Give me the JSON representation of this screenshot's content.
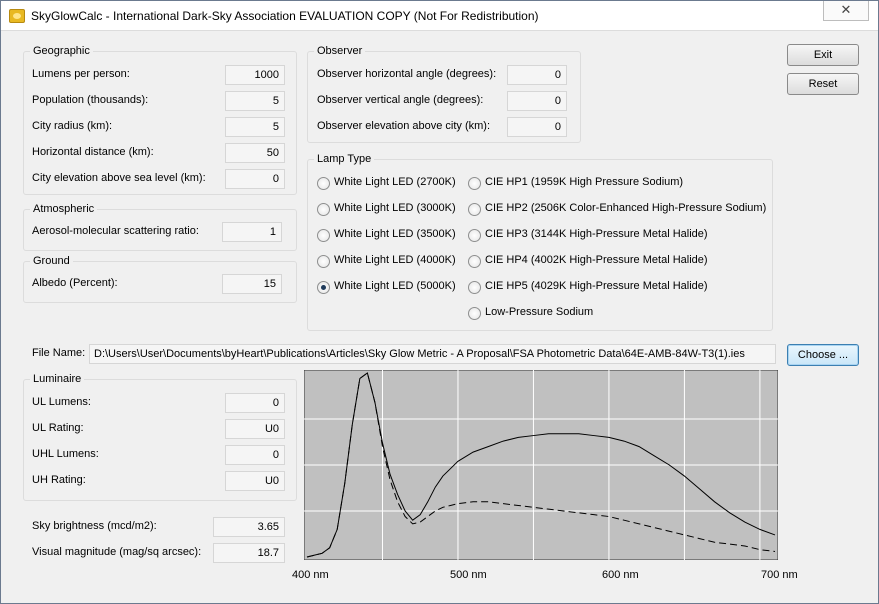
{
  "window": {
    "title": "SkyGlowCalc - International Dark-Sky Association EVALUATION COPY (Not For Redistribution)",
    "close_label": "✕"
  },
  "geographic": {
    "title": "Geographic",
    "fields": [
      {
        "label": "Lumens per person:",
        "value": "1000"
      },
      {
        "label": "Population (thousands):",
        "value": "5"
      },
      {
        "label": "City radius (km):",
        "value": "5"
      },
      {
        "label": "Horizontal distance (km):",
        "value": "50"
      },
      {
        "label": "City elevation above sea level (km):",
        "value": "0"
      }
    ]
  },
  "atmospheric": {
    "title": "Atmospheric",
    "label": "Aerosol-molecular scattering ratio:",
    "value": "1"
  },
  "ground": {
    "title": "Ground",
    "label": "Albedo (Percent):",
    "value": "15"
  },
  "observer": {
    "title": "Observer",
    "fields": [
      {
        "label": "Observer horizontal angle (degrees):",
        "value": "0"
      },
      {
        "label": "Observer vertical angle (degrees):",
        "value": "0"
      },
      {
        "label": "Observer elevation above city (km):",
        "value": "0"
      }
    ]
  },
  "lamp_type": {
    "title": "Lamp Type",
    "left": [
      {
        "label": "White Light LED (2700K)",
        "checked": false
      },
      {
        "label": "White Light LED (3000K)",
        "checked": false
      },
      {
        "label": "White Light LED (3500K)",
        "checked": false
      },
      {
        "label": "White Light LED (4000K)",
        "checked": false
      },
      {
        "label": "White Light LED (5000K)",
        "checked": true
      }
    ],
    "right": [
      {
        "label": "CIE HP1 (1959K High Pressure Sodium)",
        "checked": false
      },
      {
        "label": "CIE HP2 (2506K Color-Enhanced High-Pressure Sodium)",
        "checked": false
      },
      {
        "label": "CIE HP3 (3144K High-Pressure Metal Halide)",
        "checked": false
      },
      {
        "label": "CIE HP4 (4002K High-Pressure Metal Halide)",
        "checked": false
      },
      {
        "label": "CIE HP5 (4029K High-Pressure Metal Halide)",
        "checked": false
      },
      {
        "label": "Low-Pressure Sodium",
        "checked": false
      }
    ]
  },
  "buttons": {
    "exit": "Exit",
    "reset": "Reset",
    "choose": "Choose ..."
  },
  "file": {
    "label": "File Name:",
    "value": "D:\\Users\\User\\Documents\\byHeart\\Publications\\Articles\\Sky Glow Metric - A Proposal\\FSA Photometric Data\\64E-AMB-84W-T3(1).ies"
  },
  "luminaire": {
    "title": "Luminaire",
    "fields": [
      {
        "label": "UL Lumens:",
        "value": "0"
      },
      {
        "label": "UL Rating:",
        "value": "U0"
      },
      {
        "label": "UHL Lumens:",
        "value": "0"
      },
      {
        "label": "UH Rating:",
        "value": "U0"
      }
    ]
  },
  "results": [
    {
      "label": "Sky brightness (mcd/m2):",
      "value": "3.65"
    },
    {
      "label": "Visual magnitude (mag/sq arcsec):",
      "value": "18.7"
    }
  ],
  "chart_data": {
    "type": "line",
    "x_tick_labels": [
      "400 nm",
      "500 nm",
      "600 nm",
      "700 nm"
    ],
    "xlim": [
      400,
      710
    ],
    "ylim": [
      0,
      1
    ],
    "grid": true,
    "background_color": "#c0c0c0",
    "series": [
      {
        "style": "solid",
        "x": [
          400,
          405,
          410,
          415,
          420,
          425,
          430,
          435,
          440,
          445,
          450,
          455,
          460,
          465,
          470,
          475,
          480,
          485,
          490,
          495,
          500,
          510,
          520,
          530,
          540,
          550,
          560,
          570,
          580,
          590,
          600,
          610,
          620,
          630,
          640,
          650,
          660,
          670,
          680,
          690,
          700,
          710
        ],
        "y": [
          0.0,
          0.01,
          0.02,
          0.05,
          0.15,
          0.4,
          0.72,
          0.97,
          1.0,
          0.84,
          0.62,
          0.45,
          0.34,
          0.25,
          0.2,
          0.23,
          0.3,
          0.38,
          0.44,
          0.48,
          0.52,
          0.57,
          0.6,
          0.63,
          0.65,
          0.66,
          0.67,
          0.67,
          0.67,
          0.66,
          0.65,
          0.63,
          0.6,
          0.55,
          0.5,
          0.44,
          0.37,
          0.3,
          0.24,
          0.19,
          0.15,
          0.12
        ]
      },
      {
        "style": "dashed",
        "x": [
          400,
          405,
          410,
          415,
          420,
          425,
          430,
          435,
          440,
          445,
          450,
          455,
          460,
          465,
          470,
          475,
          480,
          485,
          490,
          495,
          500,
          510,
          520,
          530,
          540,
          550,
          560,
          570,
          580,
          590,
          600,
          610,
          620,
          630,
          640,
          650,
          660,
          670,
          680,
          690,
          700,
          710
        ],
        "y": [
          0.0,
          0.01,
          0.02,
          0.05,
          0.15,
          0.4,
          0.72,
          0.97,
          1.0,
          0.84,
          0.6,
          0.42,
          0.3,
          0.22,
          0.18,
          0.19,
          0.22,
          0.25,
          0.27,
          0.28,
          0.29,
          0.3,
          0.3,
          0.29,
          0.28,
          0.27,
          0.26,
          0.25,
          0.24,
          0.23,
          0.22,
          0.2,
          0.18,
          0.16,
          0.14,
          0.12,
          0.1,
          0.08,
          0.07,
          0.06,
          0.04,
          0.03
        ]
      }
    ]
  }
}
